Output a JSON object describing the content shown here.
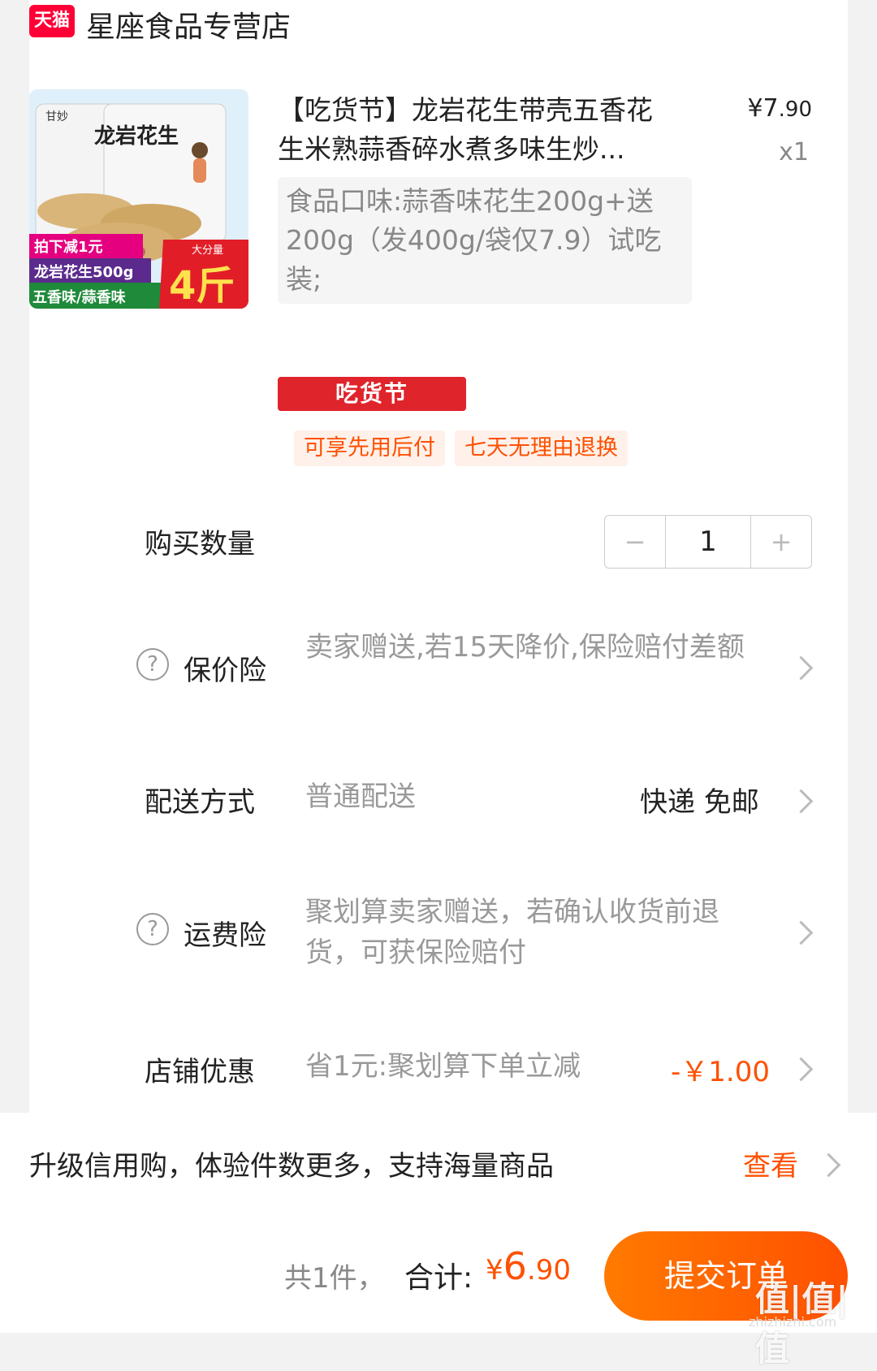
{
  "shop": {
    "badge": "天猫",
    "name": "星座食品专营店"
  },
  "product": {
    "title": "【吃货节】龙岩花生带壳五香花生米熟蒜香碎水煮多味生炒...",
    "price_symbol": "¥",
    "price_int": "7",
    "price_dec": ".90",
    "qty": "x1",
    "spec": "食品口味:蒜香味花生200g+送200g（发400g/袋仅7.9）试吃装;",
    "image_text": {
      "brand": "甘妙",
      "name": "龙岩花生",
      "promo": "拍下减1元",
      "weight": "龙岩花生500g",
      "flavors": "五香味/蒜香味",
      "big": "大分量",
      "jin": "4斤"
    },
    "festival_tag": "吃货节",
    "services": [
      "可享先用后付",
      "七天无理由退换"
    ]
  },
  "quantity": {
    "label": "购买数量",
    "minus": "−",
    "value": "1",
    "plus": "+"
  },
  "price_protect": {
    "label": "保价险",
    "help": "?",
    "text": "卖家赠送,若15天降价,保险赔付差额"
  },
  "delivery": {
    "label": "配送方式",
    "method": "普通配送",
    "value": "快递 免邮"
  },
  "freight_insurance": {
    "label": "运费险",
    "help": "?",
    "text": "聚划算卖家赠送，若确认收货前退货，可获保险赔付"
  },
  "shop_discount": {
    "label": "店铺优惠",
    "text": "省1元:聚划算下单立减",
    "value": "-￥1.00"
  },
  "credit": {
    "text": "升级信用购，体验件数更多，支持海量商品",
    "link": "查看"
  },
  "footer": {
    "count": "共1件，",
    "total_label": "合计:",
    "total_symbol": "¥",
    "total_int": "6",
    "total_dec": ".90",
    "submit": "提交订单",
    "watermark": "值|值|值",
    "watermark_site": "zhizhizhi.com"
  },
  "colors": {
    "accent": "#ff5000",
    "tmall": "#ff0036",
    "festival": "#e0242c"
  }
}
